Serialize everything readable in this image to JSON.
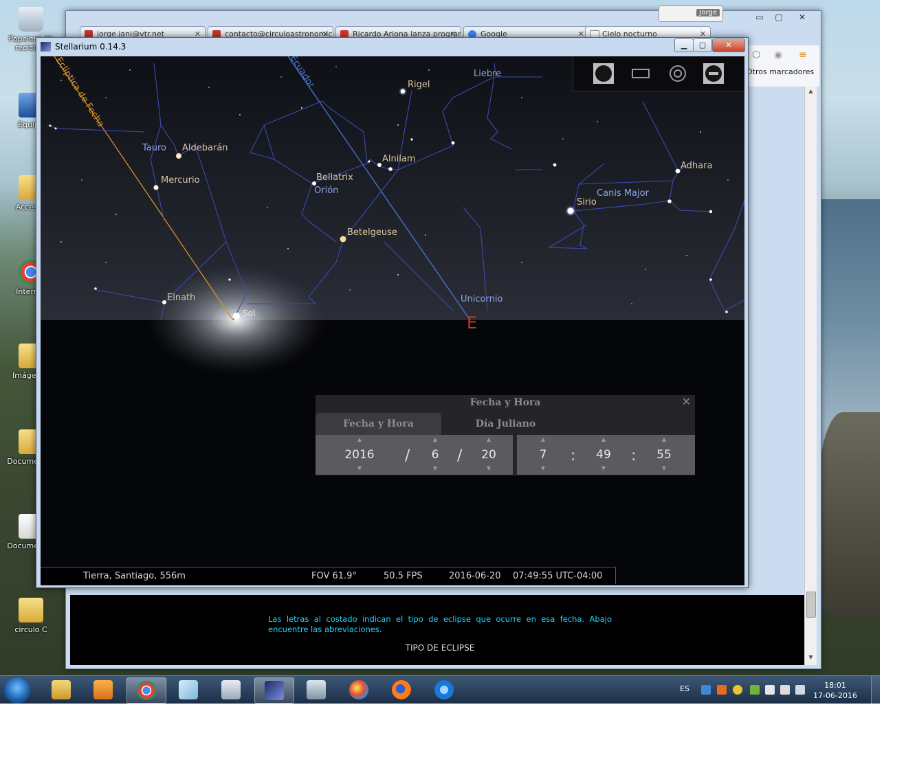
{
  "desktop": {
    "icons": [
      {
        "label": "Papelera de reciclaje",
        "icon": "recycle-bin-icon"
      },
      {
        "label": "Equipo",
        "icon": "computer-icon"
      },
      {
        "label": "Accesos",
        "icon": "folder-icon"
      },
      {
        "label": "Internet",
        "icon": "chrome-icon"
      },
      {
        "label": "Imágenes",
        "icon": "folder-icon"
      },
      {
        "label": "Documentos",
        "icon": "folder-icon"
      },
      {
        "label": "Documentos",
        "icon": "document-icon"
      },
      {
        "label": "circulo C",
        "icon": "folder-icon"
      }
    ]
  },
  "browser": {
    "user": "Jorge",
    "tabs": [
      {
        "label": "jorge.jani@vtr.net",
        "favicon_color": "#c0392b"
      },
      {
        "label": "contacto@circuloastronomico",
        "favicon_color": "#c0392b"
      },
      {
        "label": "Ricardo Ariona lanza programa",
        "favicon_color": "#d9342b"
      },
      {
        "label": "Google",
        "favicon_color": "#4285f4"
      },
      {
        "label": "Cielo nocturno",
        "favicon_color": "#888888"
      }
    ],
    "bookmarks_label": "Otros marcadores",
    "page_text": "Las letras al costado indican el tipo de eclipse que ocurre en esa fecha. Abajo encuentre las abreviaciones.",
    "page_heading": "TIPO DE ECLIPSE"
  },
  "stellarium": {
    "title": "Stellarium 0.14.3",
    "labels": {
      "ecliptic": "Eclíptica de Fecha",
      "equator": "Ecuador",
      "rigel": "Rigel",
      "lepus": "Liebre",
      "taurus": "Tauro",
      "aldebaran": "Aldebarán",
      "alnilam": "Alnilam",
      "bellatrix": "Bellatrix",
      "orion": "Orión",
      "mercury": "Mercurio",
      "adhara": "Adhara",
      "canis_major": "Canis Major",
      "sirius": "Sirio",
      "betelgeuse": "Betelgeuse",
      "elnath": "Elnath",
      "monoceros": "Unicornio",
      "sun": "Sol",
      "east": "E"
    },
    "datetime_dialog": {
      "title": "Fecha y Hora",
      "close": "✕",
      "tabs": [
        "Fecha y Hora",
        "Día Juliano"
      ],
      "year": "2016",
      "month": "6",
      "day": "20",
      "hour": "7",
      "minute": "49",
      "second": "55",
      "date_sep": "/",
      "time_sep": ":"
    },
    "status": {
      "location": "Tierra, Santiago, 556m",
      "fov": "FOV 61.9°",
      "fps": "50.5 FPS",
      "date": "2016-06-20",
      "time": "07:49:55 UTC-04:00"
    }
  },
  "taskbar": {
    "language": "ES",
    "time": "18:01",
    "date": "17-06-2016"
  },
  "colors": {
    "constellation_line": "#3b4bb0",
    "label_blue": "#8fa6e8",
    "label_star": "#d9c7a0",
    "ecliptic": "#d8902a",
    "equator": "#4a76d8",
    "cardinal": "#d8321f",
    "page_text": "#22d4ff"
  }
}
